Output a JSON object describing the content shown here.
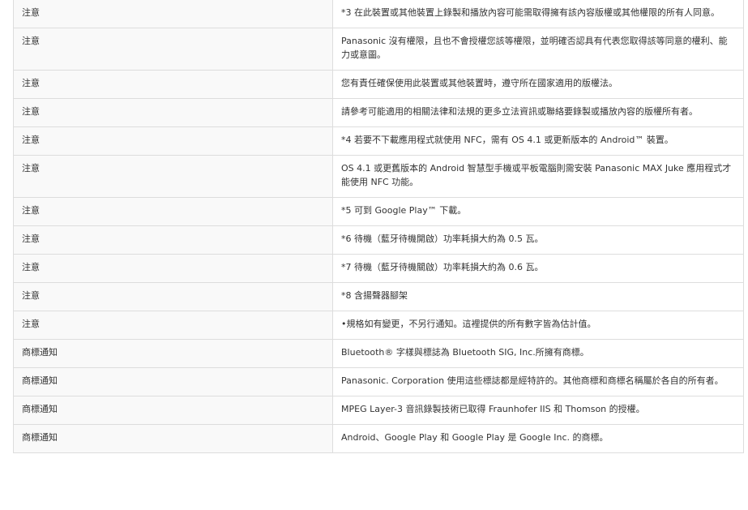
{
  "rows": [
    {
      "label": "注意",
      "value": "*3 在此裝置或其他裝置上錄製和播放內容可能需取得擁有該內容版權或其他權限的所有人同意。"
    },
    {
      "label": "注意",
      "value": "Panasonic 沒有權限，且也不會授權您該等權限，並明確否認具有代表您取得該等同意的權利、能力或意圖。"
    },
    {
      "label": "注意",
      "value": "您有責任確保使用此裝置或其他裝置時，遵守所在國家適用的版權法。"
    },
    {
      "label": "注意",
      "value": "請參考可能適用的相關法律和法規的更多立法資訊或聯絡要錄製或播放內容的版權所有者。"
    },
    {
      "label": "注意",
      "value": "*4 若要不下載應用程式就使用 NFC，需有 OS 4.1 或更新版本的 Android™ 裝置。"
    },
    {
      "label": "注意",
      "value": "OS 4.1 或更舊版本的 Android 智慧型手機或平板電腦則需安裝 Panasonic MAX Juke 應用程式才能使用 NFC 功能。"
    },
    {
      "label": "注意",
      "value": "*5 可到 Google Play™ 下載。"
    },
    {
      "label": "注意",
      "value": "*6 待機（藍牙待機開啟）功率耗損大約為 0.5 瓦。"
    },
    {
      "label": "注意",
      "value": "*7 待機（藍牙待機關啟）功率耗損大約為 0.6 瓦。"
    },
    {
      "label": "注意",
      "value": "*8 含揚聲器腳架"
    },
    {
      "label": "注意",
      "value": "•規格如有變更，不另行通知。這裡提供的所有數字皆為估計值。"
    },
    {
      "label": "商標通知",
      "value": "Bluetooth® 字樣與標誌為 Bluetooth SIG, Inc.所擁有商標。"
    },
    {
      "label": "商標通知",
      "value": "Panasonic. Corporation 使用這些標誌都是經特許的。其他商標和商標名稱屬於各自的所有者。"
    },
    {
      "label": "商標通知",
      "value": "MPEG Layer-3 音訊錄製技術已取得 Fraunhofer IIS 和 Thomson 的授權。"
    },
    {
      "label": "商標通知",
      "value": "Android、Google Play 和 Google Play 是 Google Inc. 的商標。"
    }
  ]
}
